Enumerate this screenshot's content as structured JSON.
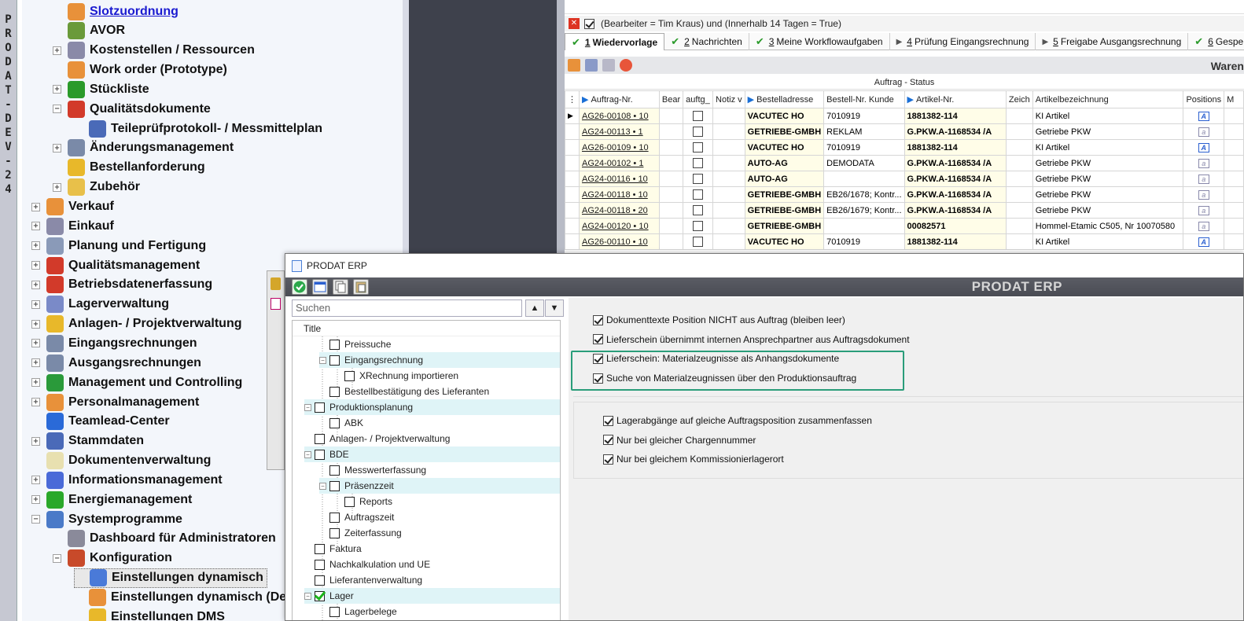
{
  "vertical_strip": [
    "P",
    "R",
    "O",
    "D",
    "A",
    "T",
    "-",
    "D",
    "E",
    "V",
    "-",
    "2",
    "4"
  ],
  "nav": {
    "items": [
      {
        "label": "Slotzuordnung",
        "indent": 1,
        "exp": "",
        "icon": "grid-icon",
        "color": "#e8913a",
        "link": true
      },
      {
        "label": "AVOR",
        "indent": 1,
        "exp": "",
        "icon": "pencil-icon",
        "color": "#6a9a3a"
      },
      {
        "label": "Kostenstellen / Ressourcen",
        "indent": 1,
        "exp": "+",
        "icon": "printer-icon",
        "color": "#8a8aa8"
      },
      {
        "label": "Work order (Prototype)",
        "indent": 1,
        "exp": "",
        "icon": "grid-icon",
        "color": "#e8913a"
      },
      {
        "label": "Stückliste",
        "indent": 1,
        "exp": "+",
        "icon": "cubes-icon",
        "color": "#2a9a2a"
      },
      {
        "label": "Qualitätsdokumente",
        "indent": 1,
        "exp": "−",
        "icon": "quality-icon",
        "color": "#d23a2a"
      },
      {
        "label": "Teileprüfprotokoll- / Messmittelplan",
        "indent": 2,
        "exp": "",
        "icon": "caliper-icon",
        "color": "#4a6ab8"
      },
      {
        "label": "Änderungsmanagement",
        "indent": 1,
        "exp": "+",
        "icon": "tools-icon",
        "color": "#7a8aa8"
      },
      {
        "label": "Bestellanforderung",
        "indent": 1,
        "exp": "",
        "icon": "basket-icon",
        "color": "#e8b82a"
      },
      {
        "label": "Zubehör",
        "indent": 1,
        "exp": "+",
        "icon": "folder-icon",
        "color": "#e8c04a"
      },
      {
        "label": "Verkauf",
        "indent": 0,
        "exp": "+",
        "icon": "handshake-icon",
        "color": "#e8913a"
      },
      {
        "label": "Einkauf",
        "indent": 0,
        "exp": "+",
        "icon": "cart-icon",
        "color": "#8a8aa8"
      },
      {
        "label": "Planung und Fertigung",
        "indent": 0,
        "exp": "+",
        "icon": "gears-icon",
        "color": "#8a9ab8"
      },
      {
        "label": "Qualitätsmanagement",
        "indent": 0,
        "exp": "+",
        "icon": "quality-icon",
        "color": "#d23a2a"
      },
      {
        "label": "Betriebsdatenerfassung",
        "indent": 0,
        "exp": "+",
        "icon": "clock-icon",
        "color": "#d23a2a"
      },
      {
        "label": "Lagerverwaltung",
        "indent": 0,
        "exp": "+",
        "icon": "clipboard-icon",
        "color": "#7a8ac8"
      },
      {
        "label": "Anlagen- / Projektverwaltung",
        "indent": 0,
        "exp": "+",
        "icon": "coins-icon",
        "color": "#e8b82a"
      },
      {
        "label": "Eingangsrechnungen",
        "indent": 0,
        "exp": "+",
        "icon": "invoice-in-icon",
        "color": "#7a8aa8"
      },
      {
        "label": "Ausgangsrechnungen",
        "indent": 0,
        "exp": "+",
        "icon": "invoice-out-icon",
        "color": "#7a8aa8"
      },
      {
        "label": "Management und Controlling",
        "indent": 0,
        "exp": "+",
        "icon": "chart-icon",
        "color": "#2a9a3a"
      },
      {
        "label": "Personalmanagement",
        "indent": 0,
        "exp": "+",
        "icon": "people-icon",
        "color": "#e8913a"
      },
      {
        "label": "Teamlead-Center",
        "indent": 0,
        "exp": "",
        "icon": "team-icon",
        "color": "#2a6ad8"
      },
      {
        "label": "Stammdaten",
        "indent": 0,
        "exp": "+",
        "icon": "table-icon",
        "color": "#4a6ab8"
      },
      {
        "label": "Dokumentenverwaltung",
        "indent": 0,
        "exp": "",
        "icon": "document-icon",
        "color": "#e8e0b0"
      },
      {
        "label": "Informationsmanagement",
        "indent": 0,
        "exp": "+",
        "icon": "info-icon",
        "color": "#4a6ad8"
      },
      {
        "label": "Energiemanagement",
        "indent": 0,
        "exp": "+",
        "icon": "battery-icon",
        "color": "#2aa82a"
      },
      {
        "label": "Systemprogramme",
        "indent": 0,
        "exp": "−",
        "icon": "database-icon",
        "color": "#4a7ac8"
      },
      {
        "label": "Dashboard für Administratoren",
        "indent": 1,
        "exp": "",
        "icon": "dashboard-icon",
        "color": "#8a8a9a"
      },
      {
        "label": "Konfiguration",
        "indent": 1,
        "exp": "−",
        "icon": "checklist-icon",
        "color": "#c84a2a"
      },
      {
        "label": "Einstellungen dynamisch",
        "indent": 2,
        "exp": "",
        "icon": "checklist-icon",
        "color": "#4a7ad8",
        "selected": true
      },
      {
        "label": "Einstellungen dynamisch (De",
        "indent": 2,
        "exp": "",
        "icon": "grid-icon",
        "color": "#e8913a"
      },
      {
        "label": "Einstellungen DMS",
        "indent": 2,
        "exp": "",
        "icon": "books-icon",
        "color": "#e8b82a"
      }
    ]
  },
  "grid": {
    "filter_text": "(Bearbeiter = Tim Kraus) und (Innerhalb 14 Tagen = True)",
    "tabs": [
      {
        "num": "1",
        "label": "Wiedervorlage",
        "mark": "check",
        "active": true
      },
      {
        "num": "2",
        "label": "Nachrichten",
        "mark": "check"
      },
      {
        "num": "3",
        "label": "Meine Workflowaufgaben",
        "mark": "check"
      },
      {
        "num": "4",
        "label": "Prüfung Eingangsrechnung",
        "mark": "arrow"
      },
      {
        "num": "5",
        "label": "Freigabe Ausgangsrechnung",
        "mark": "arrow"
      },
      {
        "num": "6",
        "label": "Gesperrte Do",
        "mark": "check"
      }
    ],
    "panel_title": "Waren",
    "status_header": "Auftrag - Status",
    "columns": [
      "Auftrag-Nr.",
      "Bear",
      "auftg_",
      "Notiz v",
      "Bestelladresse",
      "Bestell-Nr. Kunde",
      "Artikel-Nr.",
      "Zeich",
      "Artikelbezeichnung",
      "Positions",
      "M"
    ],
    "rows": [
      {
        "order": "AG26-00108 • 10",
        "addr": "VACUTEC HO",
        "cust": "7010919",
        "art": "1881382-114",
        "desc": "KI Artikel",
        "doc": "blue",
        "current": true
      },
      {
        "order": "AG24-00113 •  1",
        "addr": "GETRIEBE-GMBH",
        "cust": "REKLAM",
        "art": "G.PKW.A-1168534 /A",
        "desc": "Getriebe PKW",
        "doc": "grey"
      },
      {
        "order": "AG26-00109 • 10",
        "addr": "VACUTEC HO",
        "cust": "7010919",
        "art": "1881382-114",
        "desc": "KI Artikel",
        "doc": "blue"
      },
      {
        "order": "AG24-00102 •  1",
        "addr": "AUTO-AG",
        "cust": "DEMODATA",
        "art": "G.PKW.A-1168534 /A",
        "desc": "Getriebe PKW",
        "doc": "grey"
      },
      {
        "order": "AG24-00116 • 10",
        "addr": "AUTO-AG",
        "cust": "",
        "art": "G.PKW.A-1168534 /A",
        "desc": "Getriebe PKW",
        "doc": "grey"
      },
      {
        "order": "AG24-00118 • 10",
        "addr": "GETRIEBE-GMBH",
        "cust": "EB26/1678; Kontr...",
        "art": "G.PKW.A-1168534 /A",
        "desc": "Getriebe PKW",
        "doc": "grey"
      },
      {
        "order": "AG24-00118 • 20",
        "addr": "GETRIEBE-GMBH",
        "cust": "EB26/1679; Kontr...",
        "art": "G.PKW.A-1168534 /A",
        "desc": "Getriebe PKW",
        "doc": "grey"
      },
      {
        "order": "AG24-00120 • 10",
        "addr": "GETRIEBE-GMBH",
        "cust": "",
        "art": "00082571",
        "desc": "Hommel-Etamic C505, Nr 10070580",
        "doc": "grey"
      },
      {
        "order": "AG26-00110 • 10",
        "addr": "VACUTEC HO",
        "cust": "7010919",
        "art": "1881382-114",
        "desc": "KI Artikel",
        "doc": "blue"
      }
    ]
  },
  "dialog": {
    "title": "PRODAT ERP",
    "banner": "PRODAT ERP",
    "search_placeholder": "Suchen",
    "tree_header": "Title",
    "tree": [
      {
        "label": "Preissuche",
        "lvl": 2,
        "exp": "",
        "hl": false
      },
      {
        "label": "Eingangsrechnung",
        "lvl": 2,
        "exp": "−",
        "hl": true
      },
      {
        "label": "XRechnung importieren",
        "lvl": 3,
        "exp": "",
        "hl": false
      },
      {
        "label": "Bestellbestätigung des Lieferanten",
        "lvl": 2,
        "exp": "",
        "hl": false
      },
      {
        "label": "Produktionsplanung",
        "lvl": 1,
        "exp": "−",
        "hl": true
      },
      {
        "label": "ABK",
        "lvl": 2,
        "exp": "",
        "hl": false
      },
      {
        "label": "Anlagen- / Projektverwaltung",
        "lvl": 1,
        "exp": "",
        "hl": false
      },
      {
        "label": "BDE",
        "lvl": 1,
        "exp": "−",
        "hl": true
      },
      {
        "label": "Messwerterfassung",
        "lvl": 2,
        "exp": "",
        "hl": false
      },
      {
        "label": "Präsenzzeit",
        "lvl": 2,
        "exp": "−",
        "hl": true
      },
      {
        "label": "Reports",
        "lvl": 3,
        "exp": "",
        "hl": false
      },
      {
        "label": "Auftragszeit",
        "lvl": 2,
        "exp": "",
        "hl": false
      },
      {
        "label": "Zeiterfassung",
        "lvl": 2,
        "exp": "",
        "hl": false
      },
      {
        "label": "Faktura",
        "lvl": 1,
        "exp": "",
        "hl": false
      },
      {
        "label": "Nachkalkulation und UE",
        "lvl": 1,
        "exp": "",
        "hl": false
      },
      {
        "label": "Lieferantenverwaltung",
        "lvl": 1,
        "exp": "",
        "hl": false
      },
      {
        "label": "Lager",
        "lvl": 1,
        "exp": "−",
        "hl": true,
        "green": true
      },
      {
        "label": "Lagerbelege",
        "lvl": 2,
        "exp": "",
        "hl": false
      }
    ],
    "options_top": [
      {
        "label": "Dokumenttexte Position NICHT aus Auftrag (bleiben leer)",
        "checked": true
      },
      {
        "label": "Lieferschein übernimmt internen Ansprechpartner aus Auftragsdokument",
        "checked": true
      },
      {
        "label": "Lieferschein: Materialzeugnisse als Anhangsdokumente",
        "checked": true
      },
      {
        "label": "Suche von Materialzeugnissen über den Produktionsauftrag",
        "checked": true
      }
    ],
    "options_bottom": [
      {
        "label": "Lagerabgänge auf gleiche Auftragsposition zusammenfassen",
        "checked": true
      },
      {
        "label": "Nur bei gleicher Chargennummer",
        "checked": true
      },
      {
        "label": "Nur bei gleichem Kommissionierlagerort",
        "checked": true
      }
    ]
  }
}
